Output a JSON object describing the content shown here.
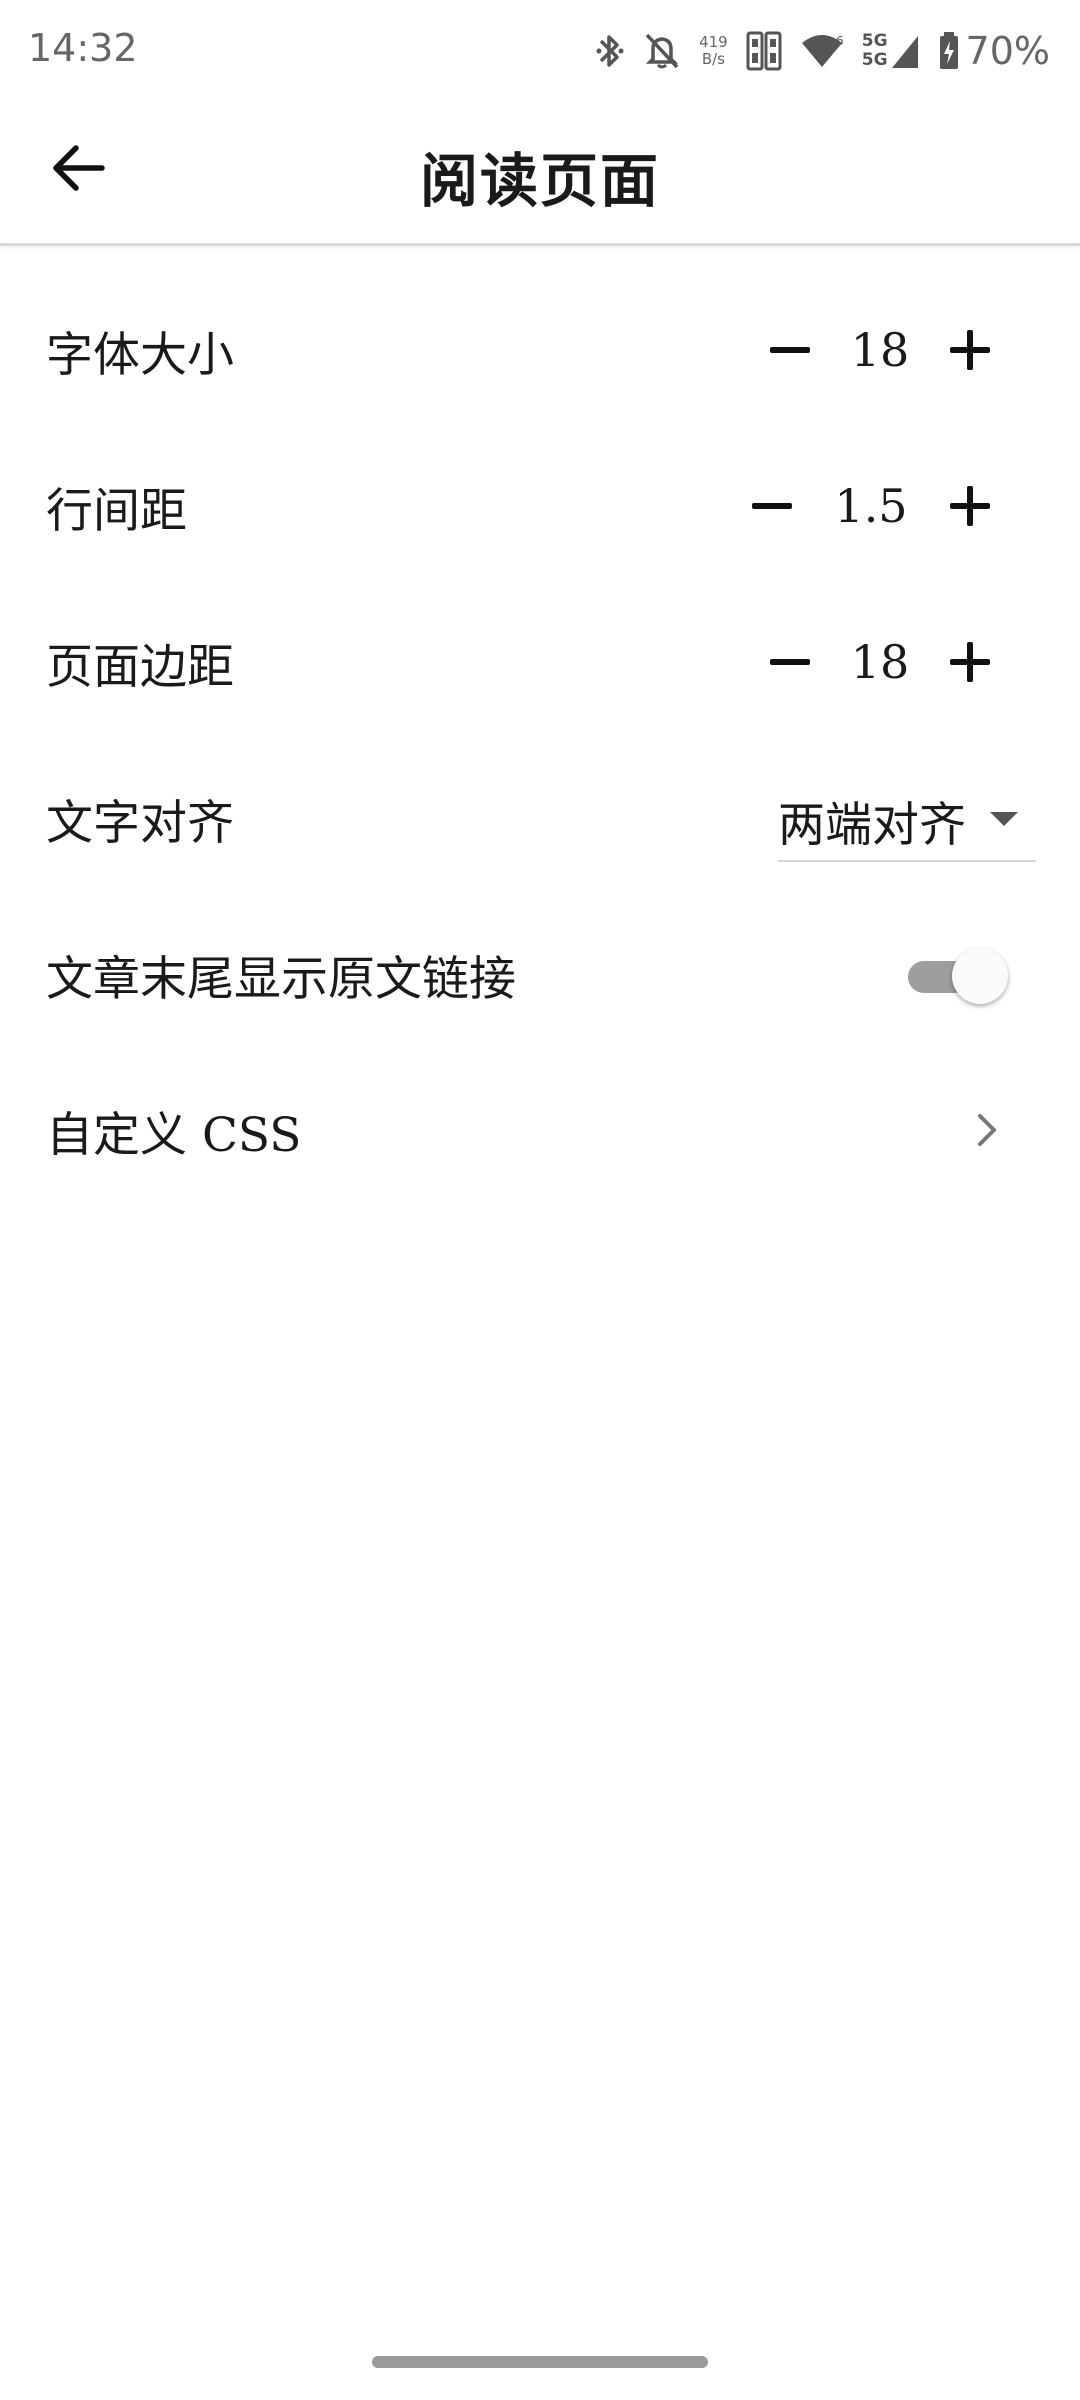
{
  "status_bar": {
    "time": "14:32",
    "net_speed_value": "419",
    "net_speed_unit": "B/s",
    "signal_label_top": "5G",
    "signal_label_bottom": "5G",
    "battery_percent": "70%",
    "icons": [
      "bluetooth-icon",
      "notifications-off-icon",
      "sim-card-icon",
      "wifi-icon",
      "cellular-signal-icon",
      "battery-charging-icon"
    ]
  },
  "app_bar": {
    "title": "阅读页面",
    "back_icon": "arrow-back-icon"
  },
  "settings": {
    "font_size": {
      "label": "字体大小",
      "value": "18"
    },
    "line_spacing": {
      "label": "行间距",
      "value": "1.5"
    },
    "page_margin": {
      "label": "页面边距",
      "value": "18"
    },
    "text_align": {
      "label": "文字对齐",
      "selected": "两端对齐"
    },
    "show_source_link": {
      "label": "文章末尾显示原文链接",
      "enabled": false
    },
    "custom_css": {
      "label": "自定义 CSS"
    }
  },
  "colors": {
    "text": "#1a1a1a",
    "divider": "#d8d8d8",
    "toggle_track_off": "#9e9e9e",
    "toggle_thumb": "#fafafa"
  }
}
